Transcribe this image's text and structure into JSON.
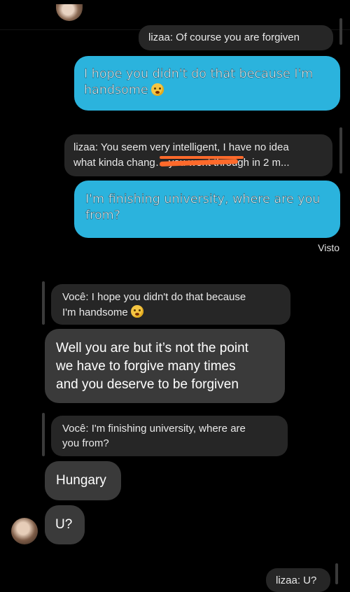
{
  "header": {
    "avatar_icon": "user-avatar-icon"
  },
  "messages": {
    "reply1": {
      "text": "lizaa: Of course you are forgiven"
    },
    "sent1": {
      "text": "I hope you didn't do that because I'm handsome"
    },
    "reply2": {
      "line1": "lizaa: You seem very intelligent, I have no idea",
      "line2": "what kinda chang… you went through in 2 m..."
    },
    "sent2": {
      "text": "I'm finishing university, where are you from?"
    },
    "seen_label": "Visto",
    "reply3": {
      "line1": "Você: I hope you didn't do that because",
      "line2": "I'm handsome"
    },
    "recv1": {
      "line1": "Well you are but it’s not the point",
      "line2": "we have to forgive many times",
      "line3": "and you deserve to be forgiven"
    },
    "reply4": {
      "line1": "Você: I'm finishing university, where are",
      "line2": "you from?"
    },
    "recv2": {
      "text": "Hungary"
    },
    "recv3": {
      "text": "U?"
    },
    "reply5": {
      "text": "lizaa: U?"
    }
  },
  "colors": {
    "sent_bubble": "#2bb3dd",
    "received_bubble": "#3a3a3a",
    "reply_bubble": "#262626",
    "highlight": "#ff6a2b"
  },
  "icons": {
    "emoji": "flushed-emoji-icon"
  }
}
